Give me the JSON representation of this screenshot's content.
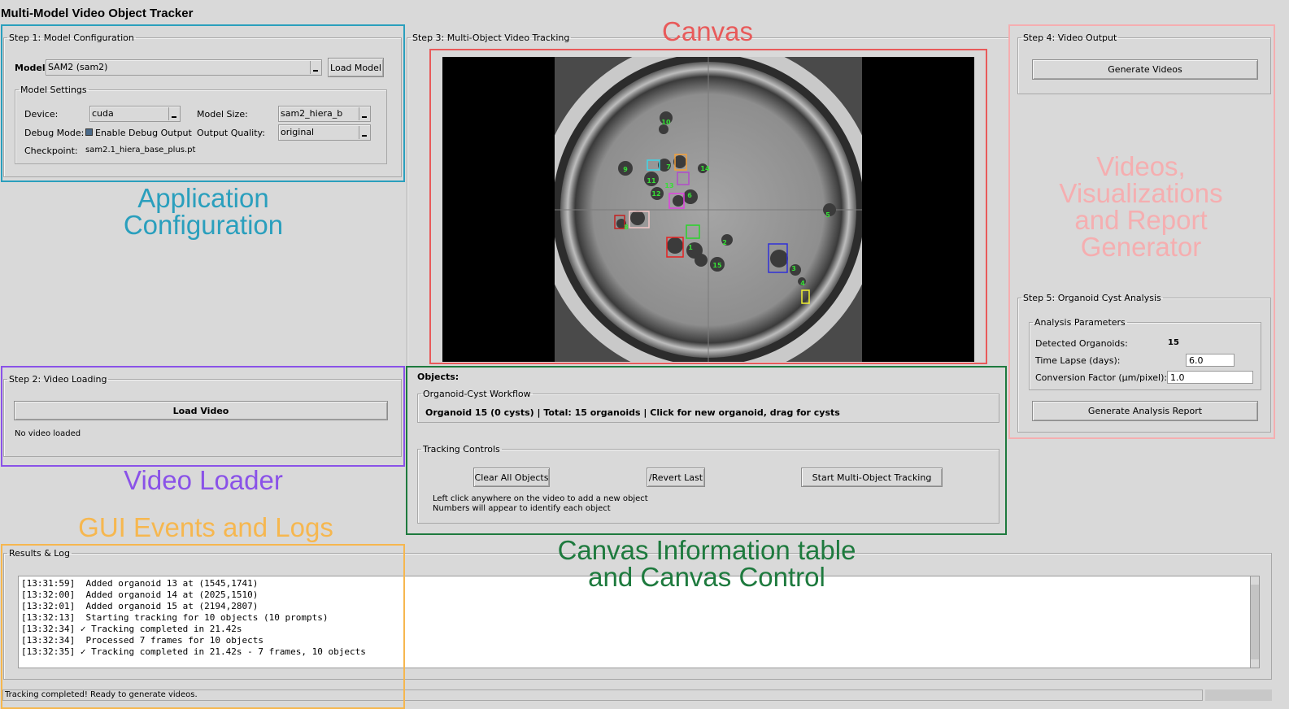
{
  "app": {
    "title": "Multi-Model Video Object Tracker"
  },
  "colors": {
    "config": "#2a9fbd",
    "canvas": "#e85a5a",
    "output": "#f5aeb0",
    "loader": "#8a52e8",
    "logs": "#f6b74f",
    "info": "#1e7a3e"
  },
  "annotations": {
    "config_line1": "Application",
    "config_line2": "Configuration",
    "canvas": "Canvas",
    "output_line1": "Videos,",
    "output_line2": "Visualizations",
    "output_line3": "and Report",
    "output_line4": "Generator",
    "loader": "Video Loader",
    "logs": "GUI Events and Logs",
    "info_line1": "Canvas Information table",
    "info_line2": "and Canvas Control"
  },
  "step1": {
    "legend": "Step 1: Model Configuration",
    "model_label": "Model:",
    "model_value": "SAM2 (sam2)",
    "load_model": "Load Model",
    "settings_legend": "Model Settings",
    "device_label": "Device:",
    "device_value": "cuda",
    "size_label": "Model Size:",
    "size_value": "sam2_hiera_b",
    "debug_label": "Debug Mode:",
    "debug_check": "Enable Debug Output",
    "quality_label": "Output Quality:",
    "quality_value": "original",
    "checkpoint_label": "Checkpoint:",
    "checkpoint_value": "sam2.1_hiera_base_plus.pt"
  },
  "step2": {
    "legend": "Step 2: Video Loading",
    "load_video": "Load Video",
    "status": "No video loaded"
  },
  "step3": {
    "legend": "Step 3: Multi-Object Video Tracking",
    "labels": [
      "10",
      "9",
      "11",
      "7",
      "14",
      "13",
      "12",
      "6",
      "5",
      "2",
      "1",
      "15",
      "3",
      "4",
      "8"
    ]
  },
  "objects": {
    "title": "Objects:",
    "workflow_legend": "Organoid-Cyst Workflow",
    "workflow_text": "Organoid 15 (0 cysts) | Total: 15 organoids | Click for new organoid, drag for cysts",
    "tracking_legend": "Tracking Controls",
    "clear": "Clear All Objects",
    "revert": "/Revert Last",
    "start": "Start Multi-Object Tracking",
    "hint1": "Left click anywhere on the video to add a new object",
    "hint2": "Numbers will appear to identify each object"
  },
  "step4": {
    "legend": "Step 4: Video Output",
    "generate": "Generate Videos"
  },
  "step5": {
    "legend": "Step 5: Organoid Cyst Analysis",
    "params_legend": "Analysis Parameters",
    "detected_label": "Detected Organoids:",
    "detected_value": "15",
    "timelapse_label": "Time Lapse (days):",
    "timelapse_value": "6.0",
    "conversion_label": "Conversion Factor (µm/pixel):",
    "conversion_value": "1.0",
    "report": "Generate Analysis Report"
  },
  "results": {
    "legend": "Results & Log",
    "lines": [
      "[13:31:59]  Added organoid 13 at (1545,1741)",
      "[13:32:00]  Added organoid 14 at (2025,1510)",
      "[13:32:01]  Added organoid 15 at (2194,2807)",
      "[13:32:13]  Starting tracking for 10 objects (10 prompts)",
      "[13:32:34] ✓ Tracking completed in 21.42s",
      "[13:32:34]  Processed 7 frames for 10 objects",
      "[13:32:35] ✓ Tracking completed in 21.42s - 7 frames, 10 objects"
    ]
  },
  "status": {
    "text": "Tracking completed! Ready to generate videos."
  }
}
